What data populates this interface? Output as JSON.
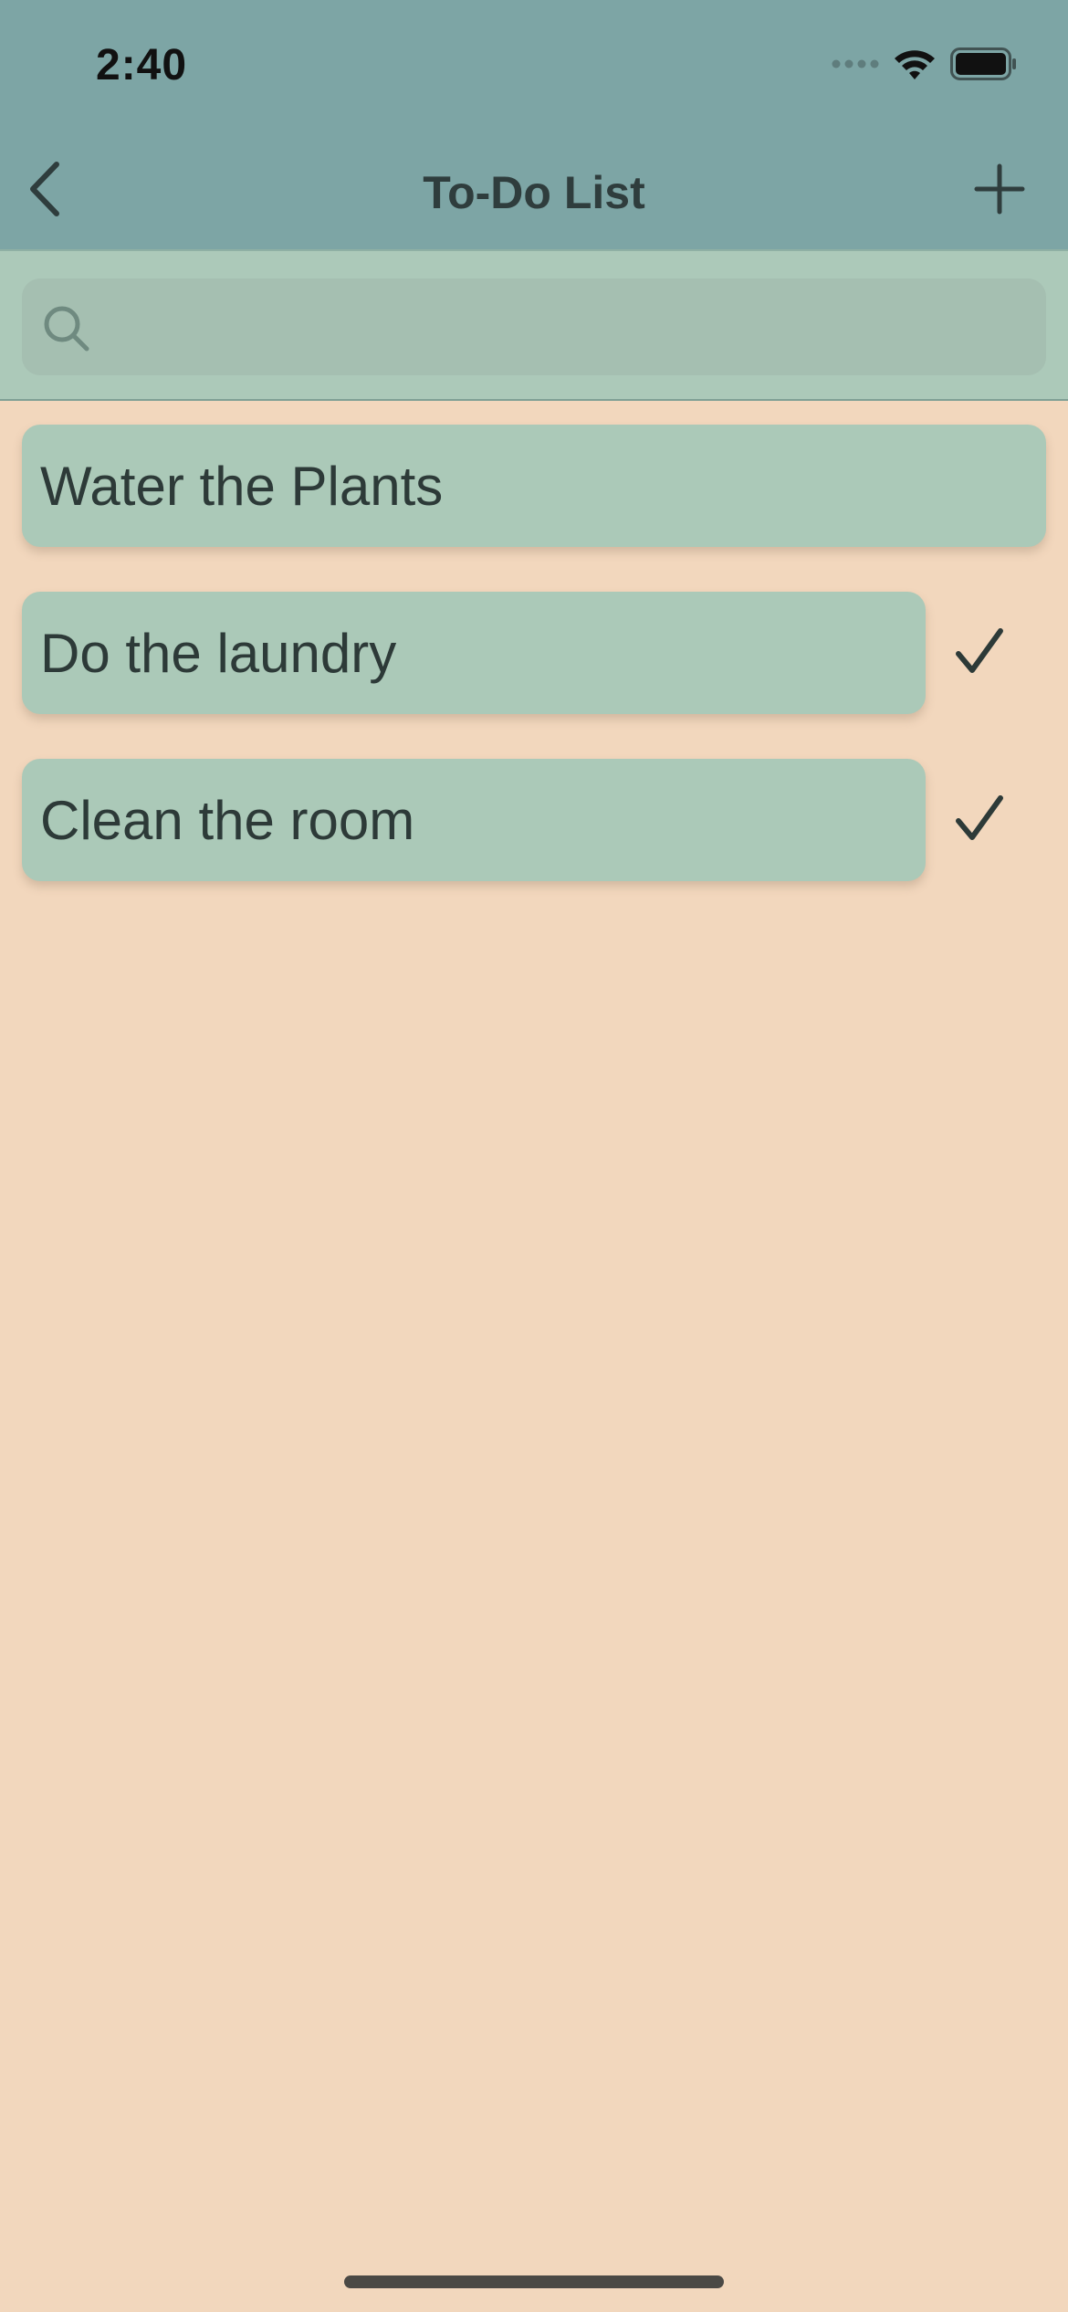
{
  "status_bar": {
    "time": "2:40",
    "icons": [
      "signal-icon",
      "wifi-icon",
      "battery-icon"
    ]
  },
  "nav": {
    "back_icon": "chevron-left-icon",
    "title": "To-Do List",
    "add_icon": "plus-icon"
  },
  "search": {
    "icon": "search-icon",
    "value": "",
    "placeholder": ""
  },
  "items": [
    {
      "label": "Water the Plants",
      "completed": false
    },
    {
      "label": "Do the laundry",
      "completed": true
    },
    {
      "label": "Clean the room",
      "completed": true
    }
  ],
  "colors": {
    "header": "#7da5a5",
    "search_bar": "#acc9b9",
    "card": "#abc9b8",
    "background": "#f2d7bd",
    "text": "#2d3a38"
  }
}
